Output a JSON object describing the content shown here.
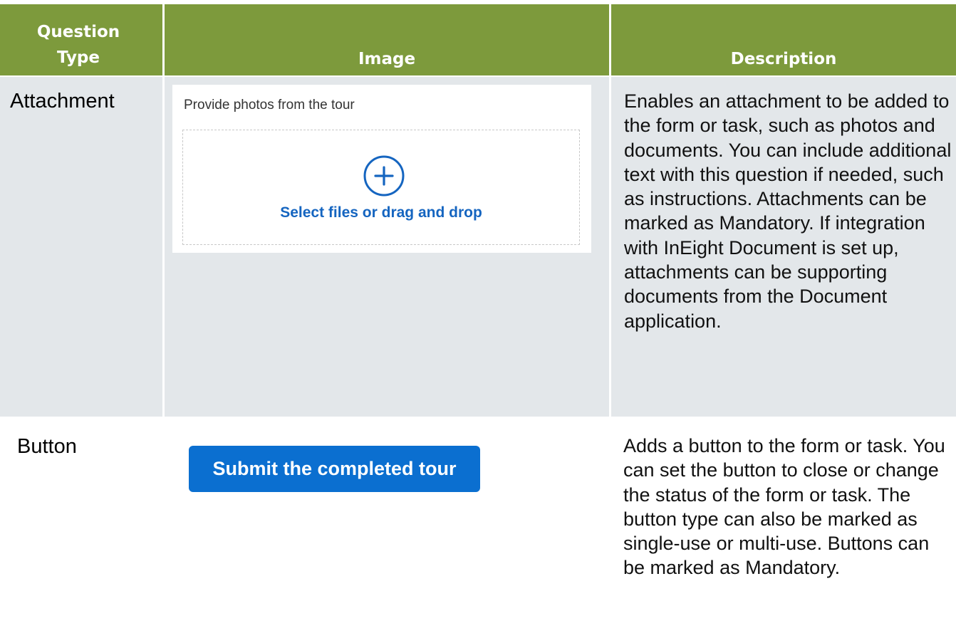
{
  "header": {
    "question_type": "Question Type",
    "image": "Image",
    "description": "Description"
  },
  "rows": [
    {
      "question_type": "Attachment",
      "image": {
        "label": "Provide photos from the tour",
        "icon": "plus-circle-icon",
        "link_text": "Select files or drag and drop"
      },
      "description": "Enables an attachment to be added to the form or task, such as photos and documents. You can include additional text with this question if needed, such as instructions. Attachments can be marked as Mandatory. If integration with InEight Document is set up, attachments can be supporting documents from the Document application."
    },
    {
      "question_type": "Button",
      "image": {
        "button_label": "Submit the completed tour"
      },
      "description": "Adds a button to the form or task. You can set the button to close or change the status of the form or task. The button type can also be marked as single-use or multi-use. Buttons can be marked as Mandatory."
    }
  ],
  "colors": {
    "header_bg": "#7d9a3c",
    "row_bg": "#e3e7ea",
    "accent_blue": "#1565c0",
    "button_blue": "#0b6fd0"
  }
}
